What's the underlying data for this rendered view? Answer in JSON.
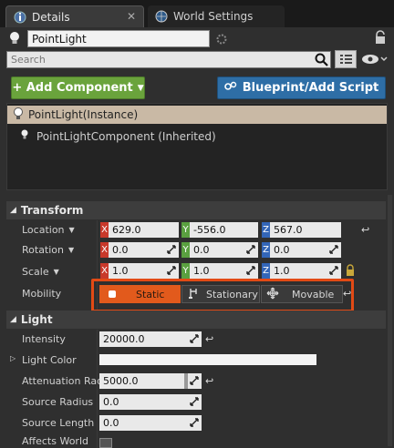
{
  "tabs": [
    {
      "label": "Details",
      "icon": "details-icon"
    },
    {
      "label": "World Settings",
      "icon": "globe-icon"
    }
  ],
  "actor": {
    "name": "PointLight"
  },
  "search": {
    "placeholder": "Search"
  },
  "buttons": {
    "add_component": "+ Add Component",
    "blueprint": "Blueprint/Add Script"
  },
  "tree": {
    "selected": "PointLight(Instance)",
    "child": "PointLightComponent (Inherited)"
  },
  "transform": {
    "header": "Transform",
    "location": {
      "label": "Location",
      "x": "629.0",
      "y": "-556.0",
      "z": "567.0"
    },
    "rotation": {
      "label": "Rotation",
      "x": "0.0",
      "y": "0.0",
      "z": "0.0"
    },
    "scale": {
      "label": "Scale",
      "x": "1.0",
      "y": "1.0",
      "z": "1.0"
    },
    "mobility": {
      "label": "Mobility",
      "options": [
        "Static",
        "Stationary",
        "Movable"
      ],
      "selected": "Static"
    }
  },
  "light": {
    "header": "Light",
    "intensity": {
      "label": "Intensity",
      "value": "20000.0"
    },
    "light_color": {
      "label": "Light Color"
    },
    "attenuation": {
      "label": "Attenuation Rad",
      "value": "5000.0"
    },
    "source_radius": {
      "label": "Source Radius",
      "value": "0.0"
    },
    "source_length": {
      "label": "Source Length",
      "value": "0.0"
    },
    "affects_world": {
      "label": "Affects World"
    }
  },
  "colors": {
    "highlight": "#e24a15",
    "add_button": "#6aa33c",
    "blueprint_button": "#2e6ea6",
    "static_selected": "#e25a1c"
  }
}
